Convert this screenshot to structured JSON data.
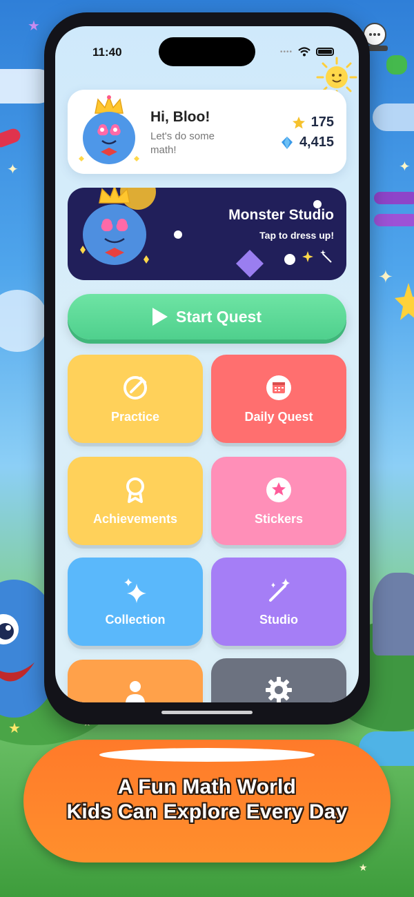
{
  "status_bar": {
    "time": "11:40"
  },
  "profile": {
    "greeting": "Hi, Bloo!",
    "subtitle": "Let's do some math!",
    "stars": "175",
    "gems": "4,415"
  },
  "studio_banner": {
    "title": "Monster Studio",
    "subtitle": "Tap to dress up!"
  },
  "start_button": {
    "label": "Start Quest"
  },
  "tiles": [
    {
      "label": "Practice",
      "icon": "pencil-circle-icon",
      "color": "#ffd15a"
    },
    {
      "label": "Daily Quest",
      "icon": "calendar-icon",
      "color": "#ff6f6f"
    },
    {
      "label": "Achievements",
      "icon": "ribbon-icon",
      "color": "#ffd15a"
    },
    {
      "label": "Stickers",
      "icon": "star-badge-icon",
      "color": "#ff8fb8"
    },
    {
      "label": "Collection",
      "icon": "sparkles-icon",
      "color": "#5ab8fb"
    },
    {
      "label": "Studio",
      "icon": "magic-wand-icon",
      "color": "#a57ef6"
    },
    {
      "label": "",
      "icon": "person-icon",
      "color": "#ffa14a"
    },
    {
      "label": "",
      "icon": "gear-icon",
      "color": "#6c7280"
    }
  ],
  "tagline": {
    "line1": "A Fun Math World",
    "line2": "Kids Can Explore Every Day"
  }
}
